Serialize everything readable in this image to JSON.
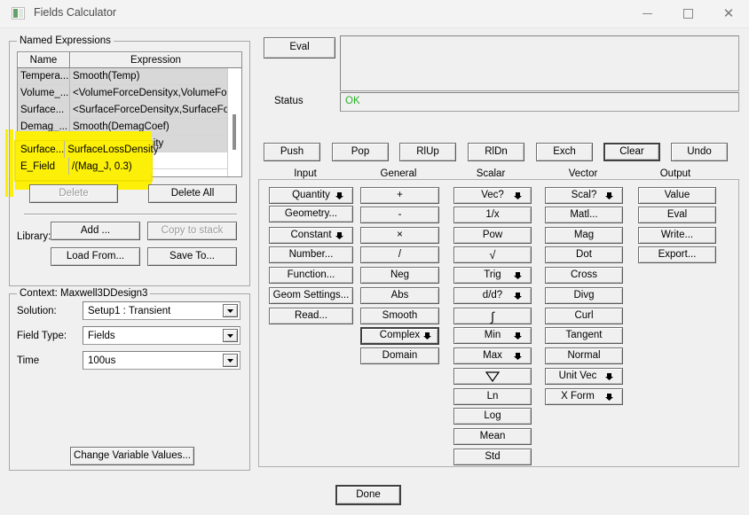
{
  "window": {
    "title": "Fields Calculator",
    "icon": "app-icon",
    "minimize": "–",
    "maximize": "□",
    "close": "✕"
  },
  "named_expressions": {
    "group_label": "Named Expressions",
    "columns": [
      "Name",
      "Expression"
    ],
    "rows": [
      {
        "name": "Tempera...",
        "expression": "Smooth(Temp)",
        "shaded": true,
        "highlighted": false
      },
      {
        "name": "Volume_...",
        "expression": "<VolumeForceDensityx,VolumeForc...",
        "shaded": true,
        "highlighted": false
      },
      {
        "name": "Surface...",
        "expression": "<SurfaceForceDensityx,SurfaceFor...",
        "shaded": true,
        "highlighted": false
      },
      {
        "name": "Demag_...",
        "expression": "Smooth(DemagCoef)",
        "shaded": true,
        "highlighted": false
      },
      {
        "name": "Surface...",
        "expression": "SurfaceLossDensity",
        "shaded": true,
        "highlighted": true
      },
      {
        "name": "E_Field",
        "expression": "/(Mag_J, 0.3)",
        "shaded": false,
        "highlighted": true
      }
    ],
    "delete": "Delete",
    "delete_all": "Delete All",
    "library_label": "Library:",
    "add": "Add ...",
    "copy_to_stack": "Copy to stack",
    "load_from": "Load From...",
    "save_to": "Save To..."
  },
  "context": {
    "group_label": "Context: Maxwell3DDesign3",
    "solution_label": "Solution:",
    "solution_value": "Setup1 : Transient",
    "field_type_label": "Field Type:",
    "field_type_value": "Fields",
    "time_label": "Time",
    "time_value": "100us",
    "change_variable_values": "Change Variable Values..."
  },
  "eval_panel": {
    "eval_button": "Eval",
    "stack_text": "",
    "status_label": "Status",
    "status_value": "OK",
    "status_color": "#2ab02a"
  },
  "stack_ops": {
    "buttons": [
      "Push",
      "Pop",
      "RlUp",
      "RlDn",
      "Exch",
      "Clear",
      "Undo"
    ],
    "default_button": "Clear"
  },
  "palette": {
    "column_headers": [
      "Input",
      "General",
      "Scalar",
      "Vector",
      "Output"
    ],
    "input": [
      {
        "label": "Quantity",
        "arrow": true
      },
      {
        "label": "Geometry...",
        "arrow": false
      },
      {
        "label": "Constant",
        "arrow": true
      },
      {
        "label": "Number...",
        "arrow": false
      },
      {
        "label": "Function...",
        "arrow": false
      },
      {
        "label": "Geom Settings...",
        "arrow": false
      },
      {
        "label": "Read...",
        "arrow": false
      }
    ],
    "general": [
      {
        "label": "+",
        "arrow": false
      },
      {
        "label": "-",
        "arrow": false
      },
      {
        "label": "×",
        "arrow": false
      },
      {
        "label": "/",
        "arrow": false
      },
      {
        "label": "Neg",
        "arrow": false
      },
      {
        "label": "Abs",
        "arrow": false
      },
      {
        "label": "Smooth",
        "arrow": false
      },
      {
        "label": "Complex",
        "arrow": true,
        "default": true
      },
      {
        "label": "Domain",
        "arrow": false
      }
    ],
    "scalar": [
      {
        "label": "Vec?",
        "arrow": true
      },
      {
        "label": "1/x",
        "arrow": false
      },
      {
        "label": "Pow",
        "arrow": false
      },
      {
        "label": "√",
        "arrow": false
      },
      {
        "label": "Trig",
        "arrow": true
      },
      {
        "label": "d/d?",
        "arrow": true
      },
      {
        "label": "∫",
        "arrow": false
      },
      {
        "label": "Min",
        "arrow": true
      },
      {
        "label": "Max",
        "arrow": true
      },
      {
        "label": "▽",
        "arrow": false
      },
      {
        "label": "Ln",
        "arrow": false
      },
      {
        "label": "Log",
        "arrow": false
      },
      {
        "label": "Mean",
        "arrow": false
      },
      {
        "label": "Std",
        "arrow": false
      }
    ],
    "vector": [
      {
        "label": "Scal?",
        "arrow": true
      },
      {
        "label": "Matl...",
        "arrow": false
      },
      {
        "label": "Mag",
        "arrow": false
      },
      {
        "label": "Dot",
        "arrow": false
      },
      {
        "label": "Cross",
        "arrow": false
      },
      {
        "label": "Divg",
        "arrow": false
      },
      {
        "label": "Curl",
        "arrow": false
      },
      {
        "label": "Tangent",
        "arrow": false
      },
      {
        "label": "Normal",
        "arrow": false
      },
      {
        "label": "Unit Vec",
        "arrow": true
      },
      {
        "label": "X Form",
        "arrow": true
      }
    ],
    "output": [
      {
        "label": "Value",
        "arrow": false
      },
      {
        "label": "Eval",
        "arrow": false
      },
      {
        "label": "Write...",
        "arrow": false
      },
      {
        "label": "Export...",
        "arrow": false
      }
    ]
  },
  "footer": {
    "done": "Done"
  },
  "annotation": {
    "highlight_color": "#fcef08"
  }
}
